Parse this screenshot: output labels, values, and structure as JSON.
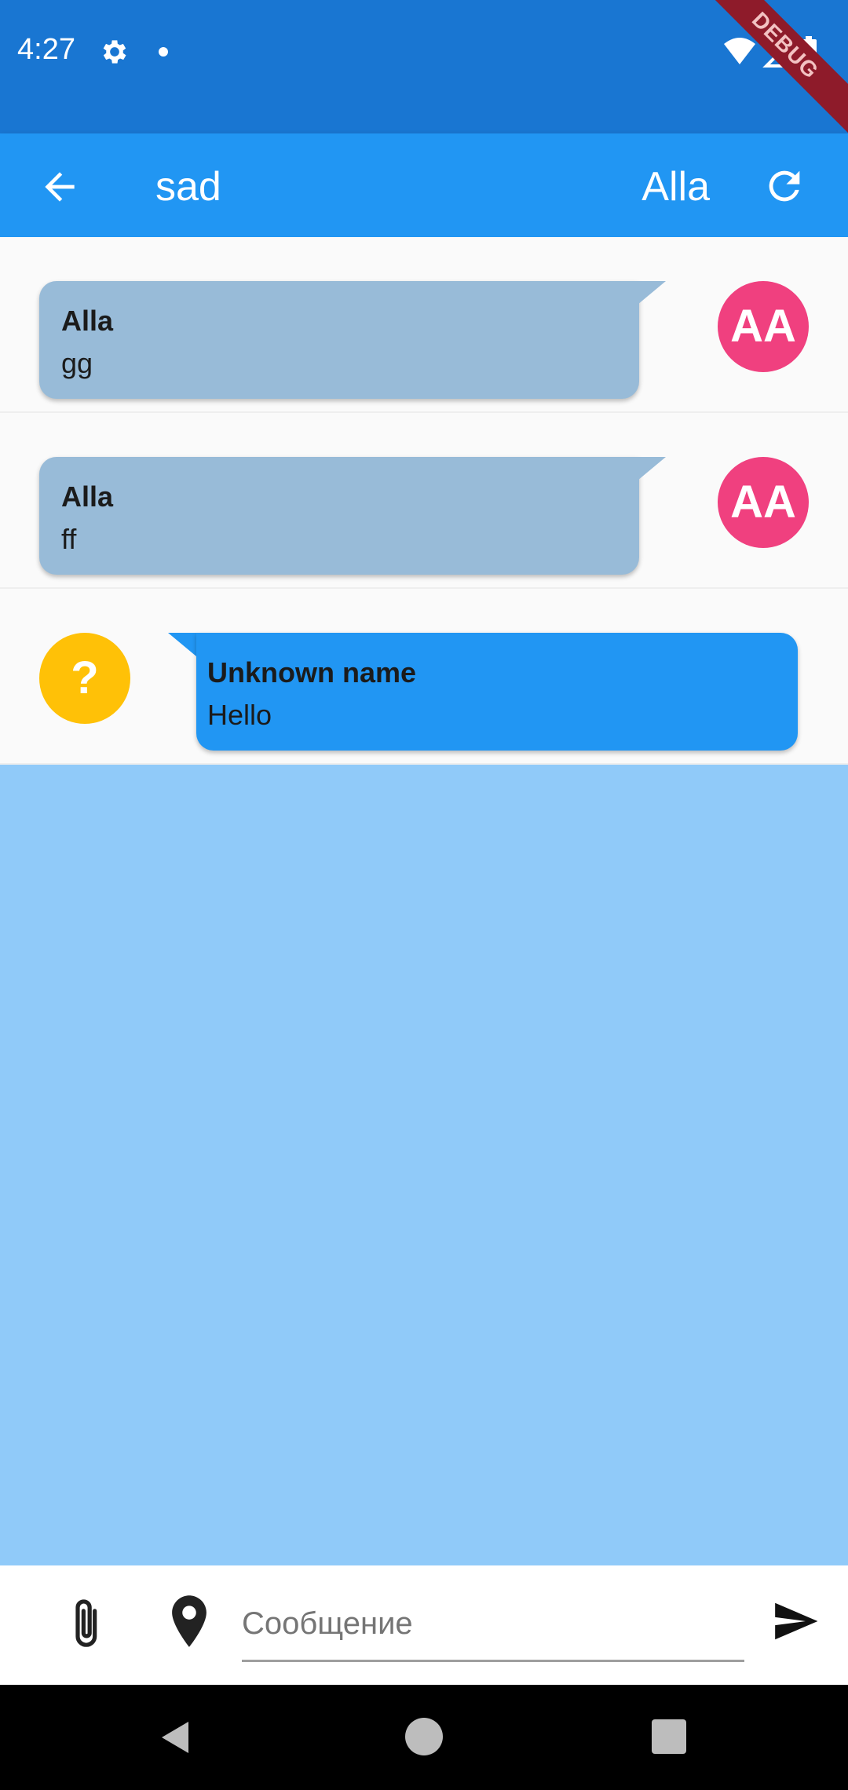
{
  "status_bar": {
    "time": "4:27",
    "debug_label": "DEBUG"
  },
  "app_bar": {
    "title": "sad",
    "user_name": "Alla"
  },
  "messages": [
    {
      "sender": "Alla",
      "text": "gg",
      "avatar": "AA",
      "side": "right"
    },
    {
      "sender": "Alla",
      "text": "ff",
      "avatar": "AA",
      "side": "right"
    },
    {
      "sender": "Unknown name",
      "text": "Hello",
      "avatar": "?",
      "side": "left"
    }
  ],
  "input": {
    "placeholder": "Сообщение",
    "value": ""
  },
  "colors": {
    "status_bar": "#1976D2",
    "app_bar": "#2196F3",
    "outgoing_bubble": "#98BBD8",
    "incoming_bubble": "#2196F3",
    "avatar_aa": "#F0407F",
    "avatar_unknown": "#FFC107",
    "chat_background": "#90CAF9"
  },
  "icons": [
    "gear-icon",
    "wifi-icon",
    "signal-icon",
    "battery-icon",
    "back-arrow-icon",
    "refresh-icon",
    "attach-icon",
    "location-icon",
    "send-icon"
  ]
}
